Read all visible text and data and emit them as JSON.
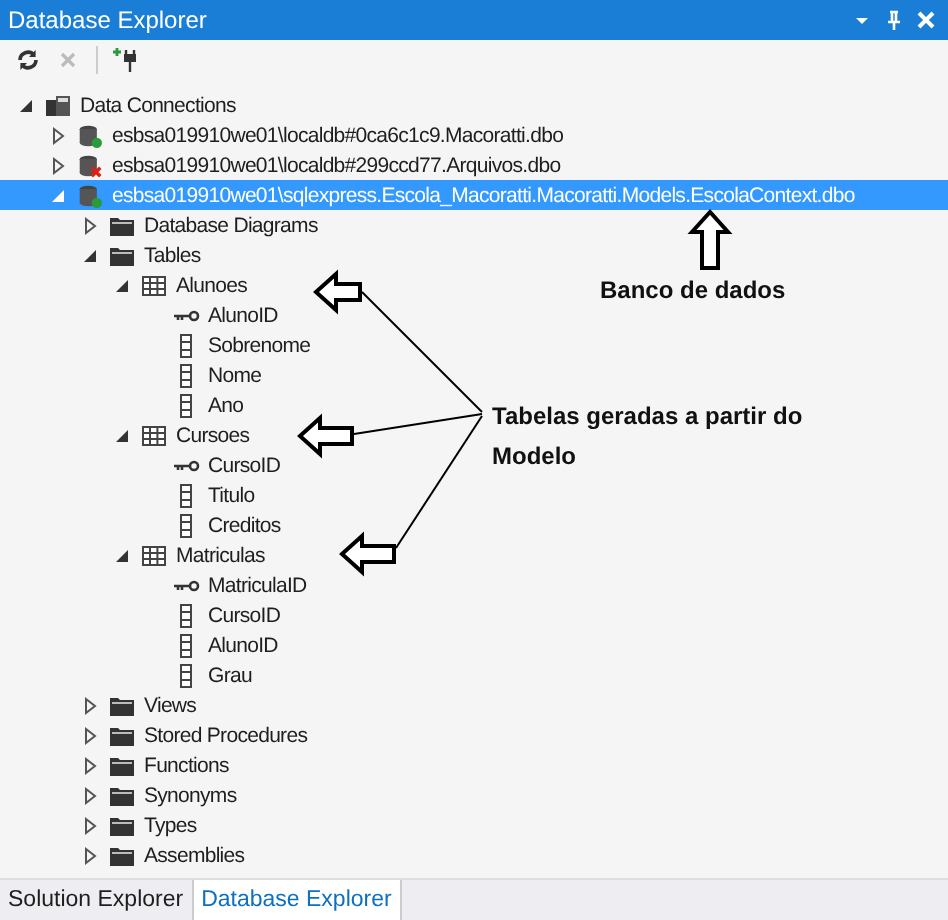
{
  "window": {
    "title": "Database Explorer"
  },
  "toolbar": [
    {
      "kind": "refresh",
      "disabled": false
    },
    {
      "kind": "delete",
      "disabled": true
    },
    {
      "kind": "connect",
      "disabled": false
    }
  ],
  "tree": [
    {
      "label": "Data Connections",
      "kind": "connections",
      "expanded": true,
      "selected": false,
      "children": [
        {
          "label": "esbsa019910we01\\localdb#0ca6c1c9.Macoratti.dbo",
          "kind": "database",
          "expanded": false,
          "selected": false
        },
        {
          "label": "esbsa019910we01\\localdb#299ccd77.Arquivos.dbo",
          "kind": "database-error",
          "expanded": false,
          "selected": false
        },
        {
          "label": "esbsa019910we01\\sqlexpress.Escola_Macoratti.Macoratti.Models.EscolaContext.dbo",
          "kind": "database",
          "expanded": true,
          "selected": true,
          "children": [
            {
              "label": "Database Diagrams",
              "kind": "folder",
              "expanded": false,
              "selected": false
            },
            {
              "label": "Tables",
              "kind": "folder",
              "expanded": true,
              "selected": false,
              "children": [
                {
                  "label": "Alunoes",
                  "kind": "table",
                  "expanded": true,
                  "selected": false,
                  "children": [
                    {
                      "label": "AlunoID",
                      "kind": "key-column",
                      "selected": false
                    },
                    {
                      "label": "Sobrenome",
                      "kind": "column",
                      "selected": false
                    },
                    {
                      "label": "Nome",
                      "kind": "column",
                      "selected": false
                    },
                    {
                      "label": "Ano",
                      "kind": "column",
                      "selected": false
                    }
                  ]
                },
                {
                  "label": "Cursoes",
                  "kind": "table",
                  "expanded": true,
                  "selected": false,
                  "children": [
                    {
                      "label": "CursoID",
                      "kind": "key-column",
                      "selected": false
                    },
                    {
                      "label": "Titulo",
                      "kind": "column",
                      "selected": false
                    },
                    {
                      "label": "Creditos",
                      "kind": "column",
                      "selected": false
                    }
                  ]
                },
                {
                  "label": "Matriculas",
                  "kind": "table",
                  "expanded": true,
                  "selected": false,
                  "children": [
                    {
                      "label": "MatriculaID",
                      "kind": "key-column",
                      "selected": false
                    },
                    {
                      "label": "CursoID",
                      "kind": "column",
                      "selected": false
                    },
                    {
                      "label": "AlunoID",
                      "kind": "column",
                      "selected": false
                    },
                    {
                      "label": "Grau",
                      "kind": "column",
                      "selected": false
                    }
                  ]
                }
              ]
            },
            {
              "label": "Views",
              "kind": "folder",
              "expanded": false,
              "selected": false
            },
            {
              "label": "Stored Procedures",
              "kind": "folder",
              "expanded": false,
              "selected": false
            },
            {
              "label": "Functions",
              "kind": "folder",
              "expanded": false,
              "selected": false
            },
            {
              "label": "Synonyms",
              "kind": "folder",
              "expanded": false,
              "selected": false
            },
            {
              "label": "Types",
              "kind": "folder",
              "expanded": false,
              "selected": false
            },
            {
              "label": "Assemblies",
              "kind": "folder",
              "expanded": false,
              "selected": false
            }
          ]
        }
      ]
    }
  ],
  "annotations": [
    {
      "text": "Banco de dados"
    },
    {
      "text": "Tabelas geradas a partir do Modelo"
    }
  ],
  "bottom_tabs": [
    {
      "label": "Solution Explorer",
      "selected": false
    },
    {
      "label": "Database Explorer",
      "selected": true
    }
  ]
}
